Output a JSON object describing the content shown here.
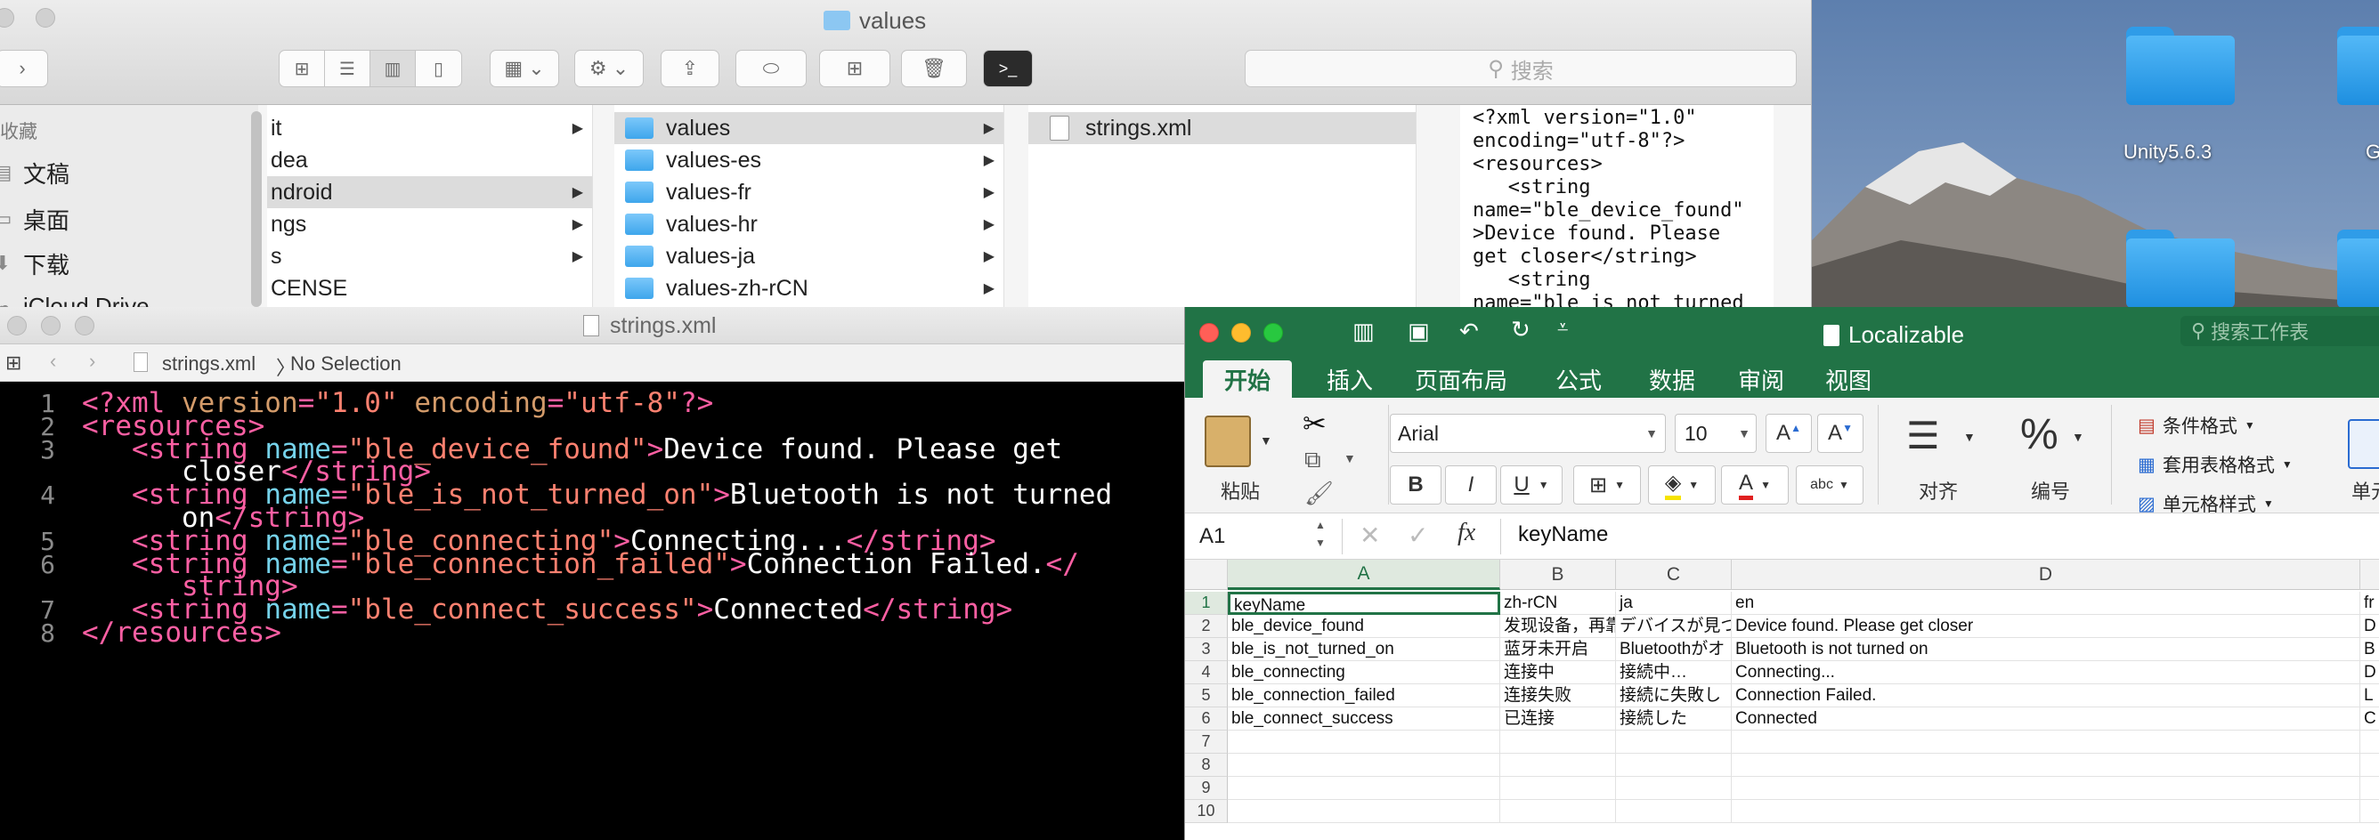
{
  "desktop": {
    "icons": [
      {
        "label": "Unity5.6.3"
      },
      {
        "label": "G"
      }
    ]
  },
  "finder": {
    "title": "values",
    "search_placeholder": "搜索",
    "sidebar": {
      "heading": "收藏",
      "items": [
        {
          "label": "文稿",
          "icon": "document-icon"
        },
        {
          "label": "桌面",
          "icon": "desktop-icon"
        },
        {
          "label": "下载",
          "icon": "download-icon"
        },
        {
          "label": "iCloud Drive",
          "icon": "cloud-icon"
        }
      ]
    },
    "columns": [
      {
        "items": [
          {
            "label": "it",
            "has_children": true,
            "selected": false
          },
          {
            "label": "dea",
            "has_children": false,
            "selected": false
          },
          {
            "label": "ndroid",
            "has_children": true,
            "selected": true
          },
          {
            "label": "ngs",
            "has_children": true,
            "selected": false
          },
          {
            "label": "s",
            "has_children": true,
            "selected": false
          },
          {
            "label": "CENSE",
            "has_children": false,
            "selected": false
          }
        ]
      },
      {
        "items": [
          {
            "label": "values",
            "has_children": true,
            "selected": true
          },
          {
            "label": "values-es",
            "has_children": true,
            "selected": false
          },
          {
            "label": "values-fr",
            "has_children": true,
            "selected": false
          },
          {
            "label": "values-hr",
            "has_children": true,
            "selected": false
          },
          {
            "label": "values-ja",
            "has_children": true,
            "selected": false
          },
          {
            "label": "values-zh-rCN",
            "has_children": true,
            "selected": false
          }
        ]
      },
      {
        "items": [
          {
            "label": "strings.xml",
            "has_children": false,
            "selected": true
          }
        ]
      }
    ],
    "preview_lines": [
      "<?xml version=\"1.0\"",
      "encoding=\"utf-8\"?>",
      "<resources>",
      "   <string",
      "name=\"ble_device_found\"",
      ">Device found. Please",
      "get closer</string>",
      "   <string",
      "name=\"ble_is_not_turned"
    ]
  },
  "xcode": {
    "window_title": "strings.xml",
    "jump_bar": {
      "file": "strings.xml",
      "selection": "No Selection"
    },
    "code": [
      {
        "n": "1",
        "parts": [
          [
            "pi",
            "<?xml "
          ],
          [
            "at",
            "version"
          ],
          [
            "pi",
            "="
          ],
          [
            "sv",
            "\"1.0\""
          ],
          [
            "pi",
            " "
          ],
          [
            "at",
            "encoding"
          ],
          [
            "pi",
            "="
          ],
          [
            "sv",
            "\"utf-8\""
          ],
          [
            "pi",
            "?>"
          ]
        ]
      },
      {
        "n": "2",
        "parts": [
          [
            "tg",
            "<resources>"
          ]
        ]
      },
      {
        "n": "3",
        "parts": [
          [
            "tg",
            "   <string "
          ],
          [
            "ag",
            "name"
          ],
          [
            "tg",
            "="
          ],
          [
            "sv",
            "\"ble_device_found\""
          ],
          [
            "tg",
            ">"
          ],
          [
            "tx",
            "Device found. Please get"
          ]
        ]
      },
      {
        "n": "",
        "parts": [
          [
            "tx",
            "      closer"
          ],
          [
            "tg",
            "</string>"
          ]
        ]
      },
      {
        "n": "4",
        "parts": [
          [
            "tg",
            "   <string "
          ],
          [
            "ag",
            "name"
          ],
          [
            "tg",
            "="
          ],
          [
            "sv",
            "\"ble_is_not_turned_on\""
          ],
          [
            "tg",
            ">"
          ],
          [
            "tx",
            "Bluetooth is not turned"
          ]
        ]
      },
      {
        "n": "",
        "parts": [
          [
            "tx",
            "      on"
          ],
          [
            "tg",
            "</string>"
          ]
        ]
      },
      {
        "n": "5",
        "parts": [
          [
            "tg",
            "   <string "
          ],
          [
            "ag",
            "name"
          ],
          [
            "tg",
            "="
          ],
          [
            "sv",
            "\"ble_connecting\""
          ],
          [
            "tg",
            ">"
          ],
          [
            "tx",
            "Connecting..."
          ],
          [
            "tg",
            "</string>"
          ]
        ]
      },
      {
        "n": "6",
        "parts": [
          [
            "tg",
            "   <string "
          ],
          [
            "ag",
            "name"
          ],
          [
            "tg",
            "="
          ],
          [
            "sv",
            "\"ble_connection_failed\""
          ],
          [
            "tg",
            ">"
          ],
          [
            "tx",
            "Connection Failed."
          ],
          [
            "tg",
            "</"
          ]
        ]
      },
      {
        "n": "",
        "parts": [
          [
            "tg",
            "      string>"
          ]
        ]
      },
      {
        "n": "7",
        "parts": [
          [
            "tg",
            "   <string "
          ],
          [
            "ag",
            "name"
          ],
          [
            "tg",
            "="
          ],
          [
            "sv",
            "\"ble_connect_success\""
          ],
          [
            "tg",
            ">"
          ],
          [
            "tx",
            "Connected"
          ],
          [
            "tg",
            "</string>"
          ]
        ]
      },
      {
        "n": "8",
        "parts": [
          [
            "tg",
            "</resources>"
          ]
        ]
      }
    ]
  },
  "excel": {
    "title": "Localizable",
    "search_placeholder": "搜索工作表",
    "tabs": [
      "开始",
      "插入",
      "页面布局",
      "公式",
      "数据",
      "审阅",
      "视图"
    ],
    "active_tab": "开始",
    "ribbon": {
      "paste": "粘贴",
      "font_name": "Arial",
      "font_size": "10",
      "align": "对齐",
      "number": "编号",
      "number_symbol": "%",
      "cond_format": "条件格式",
      "table_format": "套用表格格式",
      "cell_style": "单元格样式",
      "cell": "单元",
      "bold": "B",
      "italic": "I",
      "underline": "U",
      "abc": "abc"
    },
    "name_box": "A1",
    "fx": "fx",
    "formula": "keyName",
    "columns": [
      "A",
      "B",
      "C",
      "D",
      ""
    ],
    "row_numbers": [
      "1",
      "2",
      "3",
      "4",
      "5",
      "6",
      "7",
      "8",
      "9",
      "10"
    ],
    "rows": [
      [
        "keyName",
        "zh-rCN",
        "ja",
        "en",
        "fr"
      ],
      [
        "ble_device_found",
        "发现设备，再靠",
        "デバイスが見つ",
        "Device found. Please get closer",
        "D"
      ],
      [
        "ble_is_not_turned_on",
        "蓝牙未开启",
        "Bluetoothがオ",
        "Bluetooth is not turned on",
        "B"
      ],
      [
        "ble_connecting",
        "连接中",
        "接続中…",
        "Connecting...",
        "D"
      ],
      [
        "ble_connection_failed",
        "连接失败",
        "接続に失敗し",
        "Connection Failed.",
        "L"
      ],
      [
        "ble_connect_success",
        "已连接",
        "接続した",
        "Connected",
        "C"
      ]
    ],
    "colors": {
      "accent": "#217346"
    }
  }
}
